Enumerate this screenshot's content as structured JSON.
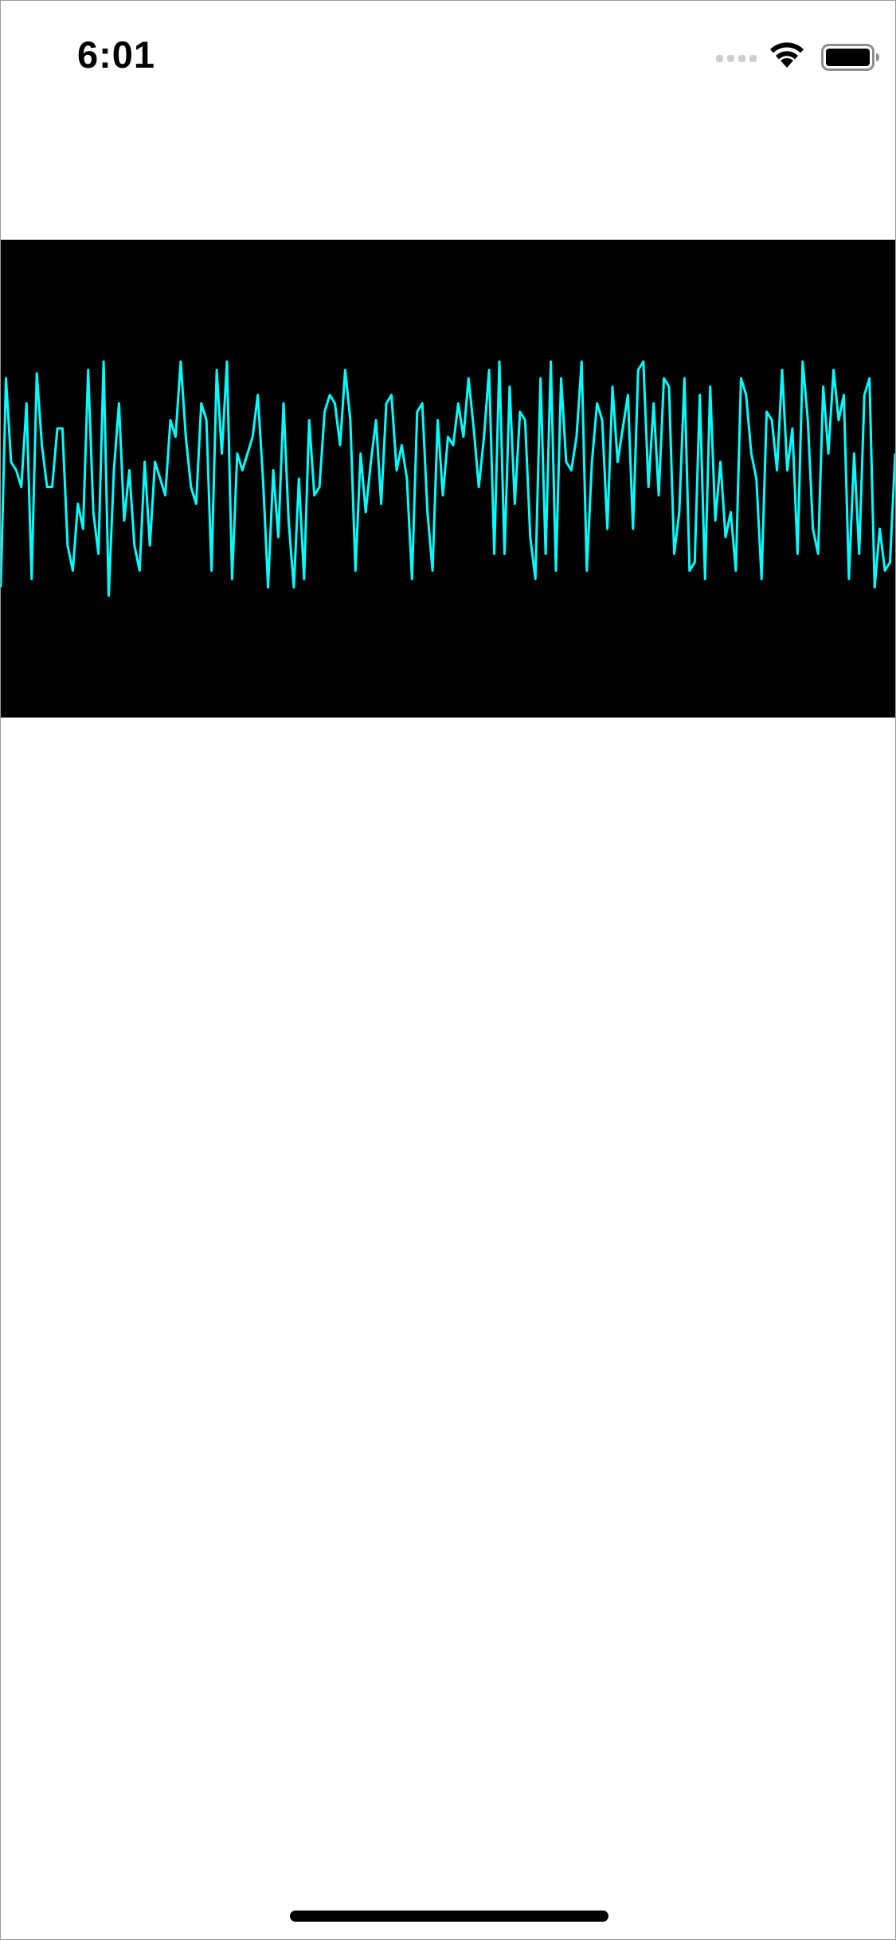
{
  "status_bar": {
    "time": "6:01",
    "icons": [
      "cellular-signal-icon",
      "wifi-icon",
      "battery-icon"
    ]
  },
  "waveform": {
    "background_color": "#000000",
    "line_color": "#00ffff",
    "amplitudes": [
      -0.65,
      0.6,
      0.1,
      0.05,
      -0.05,
      0.45,
      -0.6,
      0.63,
      0.2,
      -0.05,
      -0.05,
      0.3,
      0.3,
      -0.4,
      -0.55,
      -0.15,
      -0.3,
      0.65,
      -0.2,
      -0.45,
      0.7,
      -0.7,
      0.05,
      0.45,
      -0.25,
      0.05,
      -0.4,
      -0.55,
      0.1,
      -0.4,
      0.1,
      0.0,
      -0.1,
      0.35,
      0.25,
      0.7,
      0.25,
      -0.05,
      -0.15,
      0.45,
      0.35,
      -0.55,
      0.65,
      0.15,
      0.7,
      -0.6,
      0.15,
      0.05,
      0.15,
      0.25,
      0.5,
      0.0,
      -0.65,
      0.05,
      -0.35,
      0.45,
      -0.25,
      -0.65,
      0.0,
      -0.6,
      0.35,
      -0.1,
      -0.05,
      0.4,
      0.5,
      0.45,
      0.2,
      0.65,
      0.35,
      -0.55,
      0.15,
      -0.2,
      0.1,
      0.35,
      -0.15,
      0.45,
      0.5,
      0.05,
      0.2,
      0.0,
      -0.6,
      0.4,
      0.45,
      -0.2,
      -0.55,
      0.35,
      -0.1,
      0.25,
      0.2,
      0.45,
      0.25,
      0.6,
      0.3,
      -0.05,
      0.25,
      0.65,
      -0.45,
      0.7,
      -0.45,
      0.55,
      -0.15,
      0.4,
      0.35,
      -0.35,
      -0.6,
      0.6,
      -0.45,
      0.7,
      -0.55,
      0.6,
      0.1,
      0.05,
      0.25,
      0.7,
      -0.55,
      0.1,
      0.45,
      0.35,
      -0.3,
      0.55,
      0.1,
      0.3,
      0.5,
      -0.3,
      0.65,
      0.7,
      -0.05,
      0.45,
      -0.1,
      0.6,
      0.55,
      -0.45,
      -0.2,
      0.6,
      -0.55,
      -0.5,
      0.5,
      -0.6,
      0.55,
      -0.25,
      0.1,
      -0.35,
      -0.2,
      -0.55,
      0.6,
      0.5,
      0.15,
      0.0,
      -0.6,
      0.4,
      0.35,
      0.05,
      0.65,
      0.05,
      0.3,
      -0.45,
      0.7,
      0.35,
      -0.3,
      -0.45,
      0.55,
      0.15,
      0.65,
      0.35,
      0.5,
      -0.6,
      0.15,
      -0.45,
      0.5,
      0.6,
      -0.65,
      -0.3,
      -0.55,
      -0.5,
      0.15
    ]
  }
}
